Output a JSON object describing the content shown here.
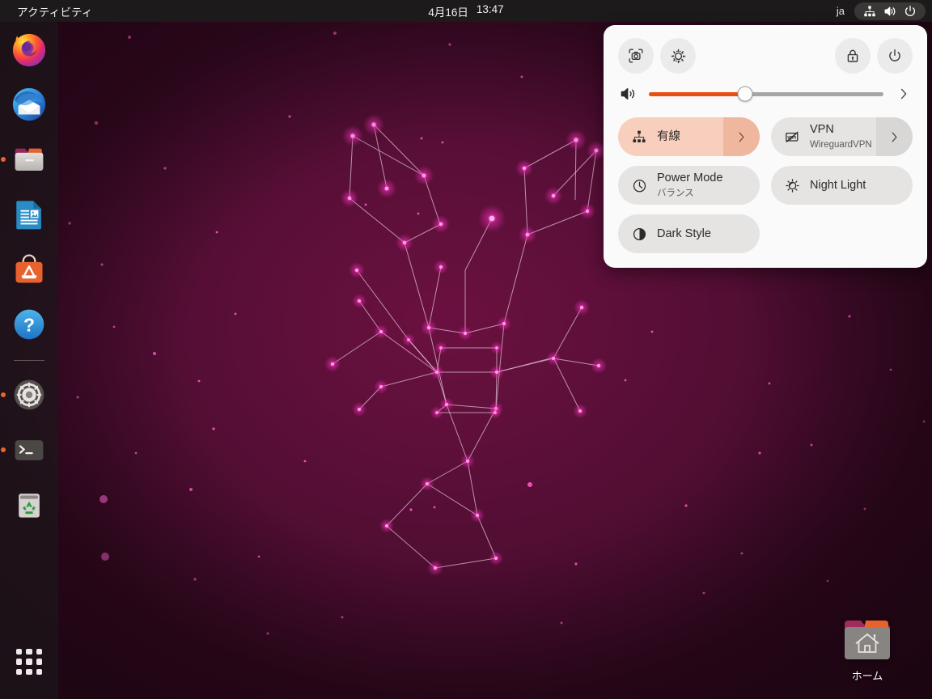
{
  "topbar": {
    "activities": "アクティビティ",
    "date": "4月16日",
    "time": "13:47",
    "keyboard_layout": "ja",
    "icons": [
      "network-wired-icon",
      "volume-icon",
      "power-icon"
    ]
  },
  "dock": {
    "items": [
      {
        "name": "firefox",
        "label": "Firefox",
        "running": false
      },
      {
        "name": "thunderbird",
        "label": "Thunderbird Mail",
        "running": false
      },
      {
        "name": "files",
        "label": "Files",
        "running": true
      },
      {
        "name": "libreoffice-writer",
        "label": "LibreOffice Writer",
        "running": false
      },
      {
        "name": "ubuntu-software",
        "label": "Ubuntu Software",
        "running": false
      },
      {
        "name": "help",
        "label": "Help",
        "running": false
      },
      {
        "name": "settings",
        "label": "Settings",
        "running": true
      },
      {
        "name": "terminal",
        "label": "Terminal",
        "running": true
      },
      {
        "name": "trash",
        "label": "Trash",
        "running": false
      }
    ],
    "apps_button_label": "アプリケーションを表示する"
  },
  "desktop": {
    "icons": [
      {
        "name": "home-folder",
        "label": "ホーム"
      }
    ],
    "wallpaper_colors": {
      "background_center": "#6b1040",
      "background_edge": "#2b0819",
      "star": "#ff2fc0",
      "line": "#e8cfe0"
    }
  },
  "quick_settings": {
    "buttons": [
      {
        "name": "screenshot",
        "icon": "screenshot-icon",
        "label": "Take Screenshot"
      },
      {
        "name": "settings",
        "icon": "gear-icon",
        "label": "Settings"
      },
      {
        "name": "lock",
        "icon": "lock-icon",
        "label": "Lock Screen"
      },
      {
        "name": "power",
        "icon": "power-icon",
        "label": "Power Off / Log Out"
      }
    ],
    "volume": {
      "icon": "volume-icon",
      "value": 41,
      "expand_label": "Sound Output Devices"
    },
    "tiles": [
      {
        "name": "network-wired",
        "icon": "network-wired-icon",
        "title": "有線",
        "subtitle": "",
        "active": true,
        "has_arrow": true
      },
      {
        "name": "vpn",
        "icon": "vpn-icon",
        "title": "VPN",
        "subtitle": "WireguardVPN",
        "active": false,
        "has_arrow": true
      },
      {
        "name": "power-mode",
        "icon": "power-mode-icon",
        "title": "Power Mode",
        "subtitle": "バランス",
        "active": false,
        "has_arrow": false
      },
      {
        "name": "night-light",
        "icon": "night-light-icon",
        "title": "Night Light",
        "subtitle": "",
        "active": false,
        "has_arrow": false
      },
      {
        "name": "dark-style",
        "icon": "dark-style-icon",
        "title": "Dark Style",
        "subtitle": "",
        "active": false,
        "has_arrow": false
      }
    ],
    "colors": {
      "panel_bg": "#fafafa",
      "tile_bg": "#e6e4e3",
      "tile_active_bg": "#f8cfbc",
      "accent": "#e8500f"
    }
  }
}
